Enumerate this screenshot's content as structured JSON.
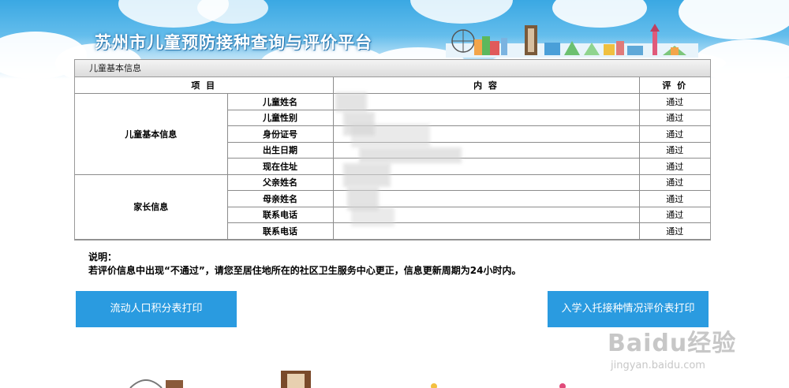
{
  "header": {
    "title": "苏州市儿童预防接种查询与评价平台"
  },
  "panel": {
    "heading": "儿童基本信息",
    "columns": {
      "item": "项 目",
      "content": "内 容",
      "evaluation": "评 价"
    },
    "groups": [
      {
        "name": "儿童基本信息",
        "rows": [
          {
            "field": "儿童姓名",
            "result": "通过"
          },
          {
            "field": "儿童性别",
            "result": "通过"
          },
          {
            "field": "身份证号",
            "result": "通过"
          },
          {
            "field": "出生日期",
            "result": "通过"
          },
          {
            "field": "现在住址",
            "result": "通过"
          }
        ]
      },
      {
        "name": "家长信息",
        "rows": [
          {
            "field": "父亲姓名",
            "result": "通过"
          },
          {
            "field": "母亲姓名",
            "result": "通过"
          },
          {
            "field": "联系电话",
            "result": "通过"
          },
          {
            "field": "联系电话",
            "result": "通过"
          }
        ]
      }
    ]
  },
  "note": {
    "label": "说明：",
    "text": "若评价信息中出现“不通过”，请您至居住地所在的社区卫生服务中心更正，信息更新周期为24小时内。"
  },
  "buttons": {
    "left": "流动人口积分表打印",
    "right": "入学入托接种情况评价表打印"
  },
  "watermark": {
    "logo": "Baidu经验",
    "url": "jingyan.baidu.com"
  },
  "colors": {
    "button": "#2a9be0",
    "sky": "#3aa8e3"
  }
}
